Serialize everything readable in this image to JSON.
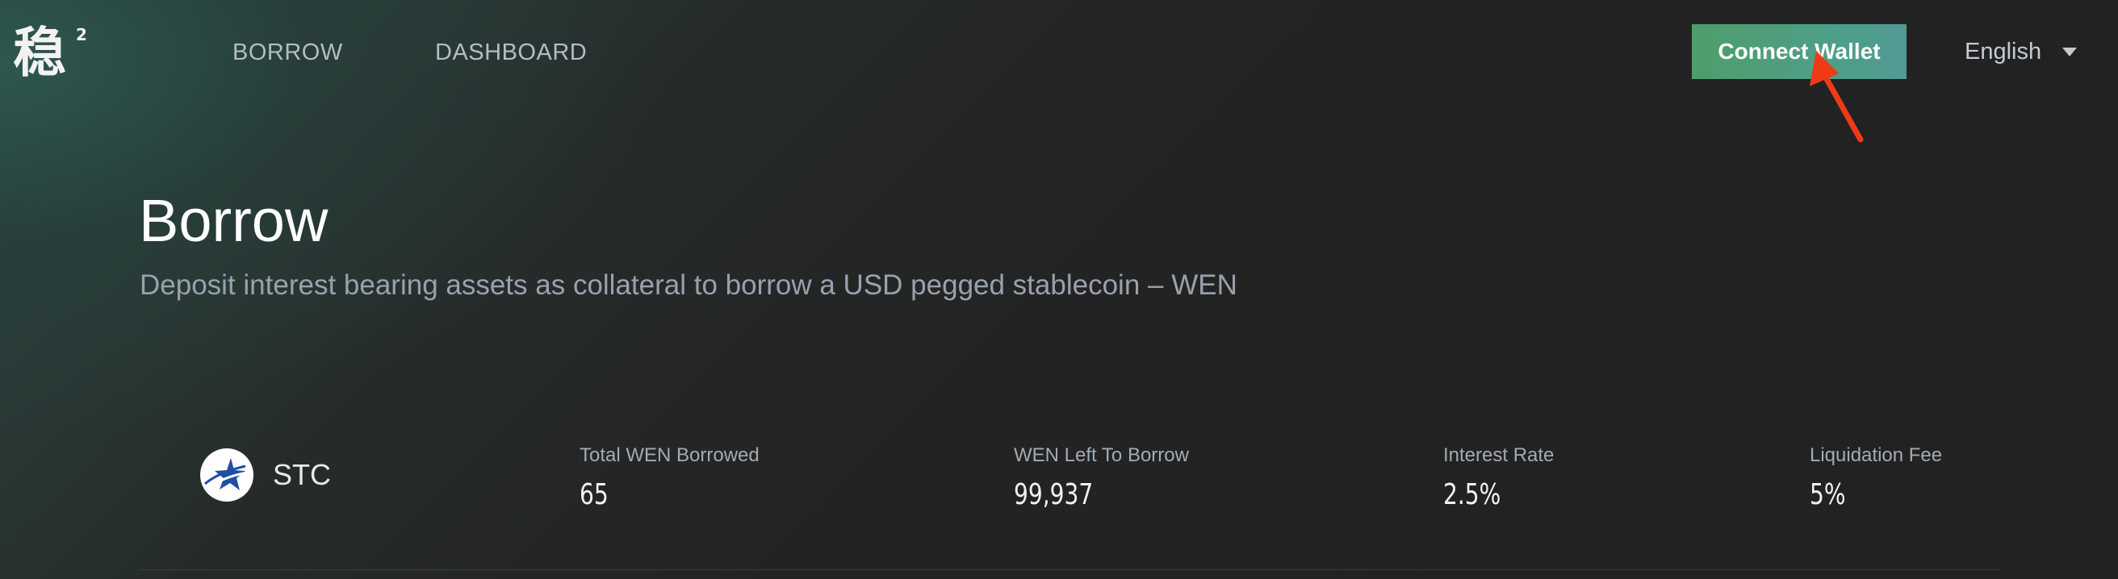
{
  "header": {
    "logo_glyph": "稳",
    "logo_superscript": "2",
    "nav": [
      {
        "label": "BORROW"
      },
      {
        "label": "DASHBOARD"
      }
    ],
    "connect_wallet_label": "Connect Wallet",
    "language": "English"
  },
  "hero": {
    "title": "Borrow",
    "subtitle": "Deposit interest bearing assets as collateral to borrow a USD pegged stablecoin – WEN"
  },
  "market": {
    "asset_name": "STC",
    "stats": [
      {
        "label": "Total WEN Borrowed",
        "value": "65"
      },
      {
        "label": "WEN Left To Borrow",
        "value": "99,937"
      },
      {
        "label": "Interest Rate",
        "value": "2.5%"
      },
      {
        "label": "Liquidation Fee",
        "value": "5%"
      }
    ]
  },
  "colors": {
    "accent_button": "#4e9f86",
    "annotation_arrow": "#f03a17",
    "background": "#232323"
  }
}
